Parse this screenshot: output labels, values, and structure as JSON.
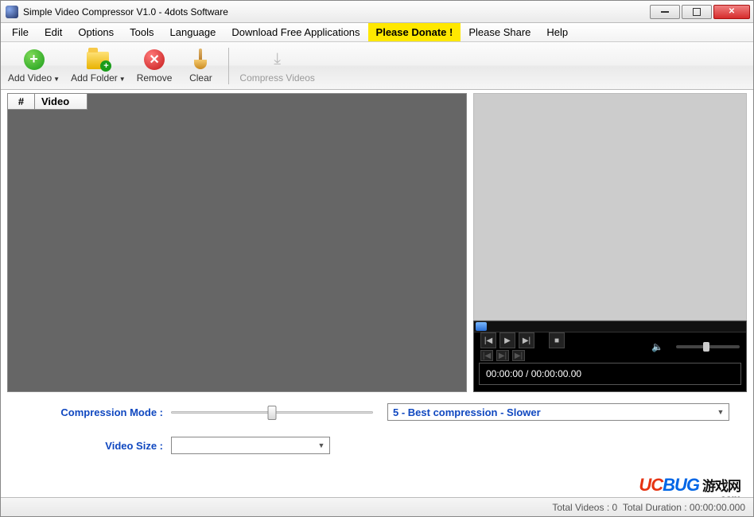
{
  "window": {
    "title": "Simple Video Compressor V1.0 - 4dots Software"
  },
  "menu": {
    "file": "File",
    "edit": "Edit",
    "options": "Options",
    "tools": "Tools",
    "language": "Language",
    "download": "Download Free Applications",
    "donate": "Please Donate !",
    "share": "Please Share",
    "help": "Help"
  },
  "toolbar": {
    "add_video": "Add Video",
    "add_folder": "Add Folder",
    "remove": "Remove",
    "clear": "Clear",
    "compress": "Compress Videos"
  },
  "list": {
    "col_num": "#",
    "col_video": "Video"
  },
  "player": {
    "time": "00:00:00 / 00:00:00.00"
  },
  "form": {
    "compression_label": "Compression Mode :",
    "compression_value": "5 - Best compression - Slower",
    "video_size_label": "Video Size :"
  },
  "status": {
    "total_videos_label": "Total Videos :",
    "total_videos_value": "0",
    "total_duration_label": "Total Duration :",
    "total_duration_value": "00:00:00.000"
  },
  "watermark": {
    "a": "UC",
    "b": "BUG",
    "c": "游戏网",
    "d": ".com"
  }
}
